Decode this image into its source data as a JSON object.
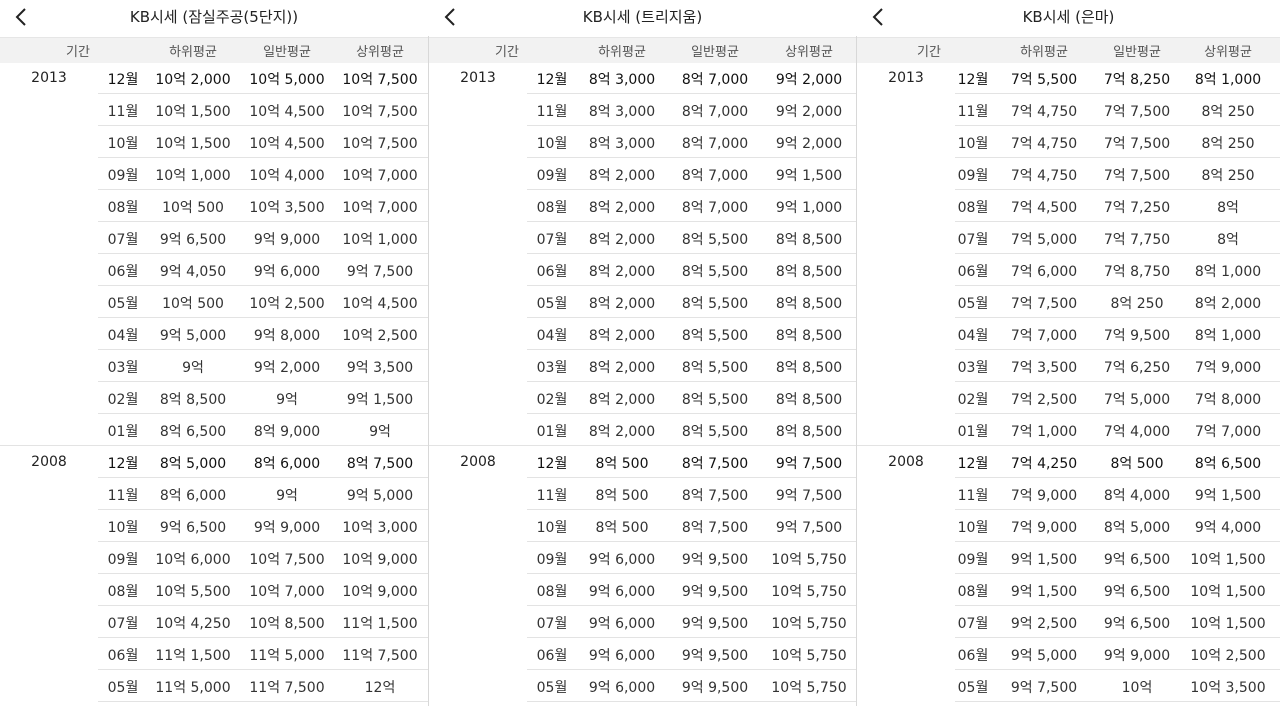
{
  "columns": {
    "period": "기간",
    "low": "하위평균",
    "mid": "일반평균",
    "high": "상위평균"
  },
  "panels": [
    {
      "title": "KB시세 (잠실주공(5단지))",
      "groups": [
        {
          "year": "2013",
          "rows": [
            [
              "12월",
              "10억 2,000",
              "10억 5,000",
              "10억 7,500"
            ],
            [
              "11월",
              "10억 1,500",
              "10억 4,500",
              "10억 7,500"
            ],
            [
              "10월",
              "10억 1,500",
              "10억 4,500",
              "10억 7,500"
            ],
            [
              "09월",
              "10억 1,000",
              "10억 4,000",
              "10억 7,000"
            ],
            [
              "08월",
              "10억 500",
              "10억 3,500",
              "10억 7,000"
            ],
            [
              "07월",
              "9억 6,500",
              "9억 9,000",
              "10억 1,000"
            ],
            [
              "06월",
              "9억 4,050",
              "9억 6,000",
              "9억 7,500"
            ],
            [
              "05월",
              "10억 500",
              "10억 2,500",
              "10억 4,500"
            ],
            [
              "04월",
              "9억 5,000",
              "9억 8,000",
              "10억 2,500"
            ],
            [
              "03월",
              "9억",
              "9억 2,000",
              "9억 3,500"
            ],
            [
              "02월",
              "8억 8,500",
              "9억",
              "9억 1,500"
            ],
            [
              "01월",
              "8억 6,500",
              "8억 9,000",
              "9억"
            ]
          ]
        },
        {
          "year": "2008",
          "rows": [
            [
              "12월",
              "8억 5,000",
              "8억 6,000",
              "8억 7,500"
            ],
            [
              "11월",
              "8억 6,000",
              "9억",
              "9억 5,000"
            ],
            [
              "10월",
              "9억 6,500",
              "9억 9,000",
              "10억 3,000"
            ],
            [
              "09월",
              "10억 6,000",
              "10억 7,500",
              "10억 9,000"
            ],
            [
              "08월",
              "10억 5,500",
              "10억 7,000",
              "10억 9,000"
            ],
            [
              "07월",
              "10억 4,250",
              "10억 8,500",
              "11억 1,500"
            ],
            [
              "06월",
              "11억 1,500",
              "11억 5,000",
              "11억 7,500"
            ],
            [
              "05월",
              "11억 5,000",
              "11억 7,500",
              "12억"
            ]
          ]
        }
      ]
    },
    {
      "title": "KB시세 (트리지움)",
      "groups": [
        {
          "year": "2013",
          "rows": [
            [
              "12월",
              "8억 3,000",
              "8억 7,000",
              "9억 2,000"
            ],
            [
              "11월",
              "8억 3,000",
              "8억 7,000",
              "9억 2,000"
            ],
            [
              "10월",
              "8억 3,000",
              "8억 7,000",
              "9억 2,000"
            ],
            [
              "09월",
              "8억 2,000",
              "8억 7,000",
              "9억 1,500"
            ],
            [
              "08월",
              "8억 2,000",
              "8억 7,000",
              "9억 1,000"
            ],
            [
              "07월",
              "8억 2,000",
              "8억 5,500",
              "8억 8,500"
            ],
            [
              "06월",
              "8억 2,000",
              "8억 5,500",
              "8억 8,500"
            ],
            [
              "05월",
              "8억 2,000",
              "8억 5,500",
              "8억 8,500"
            ],
            [
              "04월",
              "8억 2,000",
              "8억 5,500",
              "8억 8,500"
            ],
            [
              "03월",
              "8억 2,000",
              "8억 5,500",
              "8억 8,500"
            ],
            [
              "02월",
              "8억 2,000",
              "8억 5,500",
              "8억 8,500"
            ],
            [
              "01월",
              "8억 2,000",
              "8억 5,500",
              "8억 8,500"
            ]
          ]
        },
        {
          "year": "2008",
          "rows": [
            [
              "12월",
              "8억 500",
              "8억 7,500",
              "9억 7,500"
            ],
            [
              "11월",
              "8억 500",
              "8억 7,500",
              "9억 7,500"
            ],
            [
              "10월",
              "8억 500",
              "8억 7,500",
              "9억 7,500"
            ],
            [
              "09월",
              "9억 6,000",
              "9억 9,500",
              "10억 5,750"
            ],
            [
              "08월",
              "9억 6,000",
              "9억 9,500",
              "10억 5,750"
            ],
            [
              "07월",
              "9억 6,000",
              "9억 9,500",
              "10억 5,750"
            ],
            [
              "06월",
              "9억 6,000",
              "9억 9,500",
              "10억 5,750"
            ],
            [
              "05월",
              "9억 6,000",
              "9억 9,500",
              "10억 5,750"
            ]
          ]
        }
      ]
    },
    {
      "title": "KB시세 (은마)",
      "groups": [
        {
          "year": "2013",
          "rows": [
            [
              "12월",
              "7억 5,500",
              "7억 8,250",
              "8억 1,000"
            ],
            [
              "11월",
              "7억 4,750",
              "7억 7,500",
              "8억 250"
            ],
            [
              "10월",
              "7억 4,750",
              "7억 7,500",
              "8억 250"
            ],
            [
              "09월",
              "7억 4,750",
              "7억 7,500",
              "8억 250"
            ],
            [
              "08월",
              "7억 4,500",
              "7억 7,250",
              "8억"
            ],
            [
              "07월",
              "7억 5,000",
              "7억 7,750",
              "8억"
            ],
            [
              "06월",
              "7억 6,000",
              "7억 8,750",
              "8억 1,000"
            ],
            [
              "05월",
              "7억 7,500",
              "8억 250",
              "8억 2,000"
            ],
            [
              "04월",
              "7억 7,000",
              "7억 9,500",
              "8억 1,000"
            ],
            [
              "03월",
              "7억 3,500",
              "7억 6,250",
              "7억 9,000"
            ],
            [
              "02월",
              "7억 2,500",
              "7억 5,000",
              "7억 8,000"
            ],
            [
              "01월",
              "7억 1,000",
              "7억 4,000",
              "7억 7,000"
            ]
          ]
        },
        {
          "year": "2008",
          "rows": [
            [
              "12월",
              "7억 4,250",
              "8억 500",
              "8억 6,500"
            ],
            [
              "11월",
              "7억 9,000",
              "8억 4,000",
              "9억 1,500"
            ],
            [
              "10월",
              "7억 9,000",
              "8억 5,000",
              "9억 4,000"
            ],
            [
              "09월",
              "9억 1,500",
              "9억 6,500",
              "10억 1,500"
            ],
            [
              "08월",
              "9억 1,500",
              "9억 6,500",
              "10억 1,500"
            ],
            [
              "07월",
              "9억 2,500",
              "9억 6,500",
              "10억 1,500"
            ],
            [
              "06월",
              "9억 5,000",
              "9억 9,000",
              "10억 2,500"
            ],
            [
              "05월",
              "9억 7,500",
              "10억",
              "10억 3,500"
            ]
          ]
        }
      ]
    }
  ]
}
